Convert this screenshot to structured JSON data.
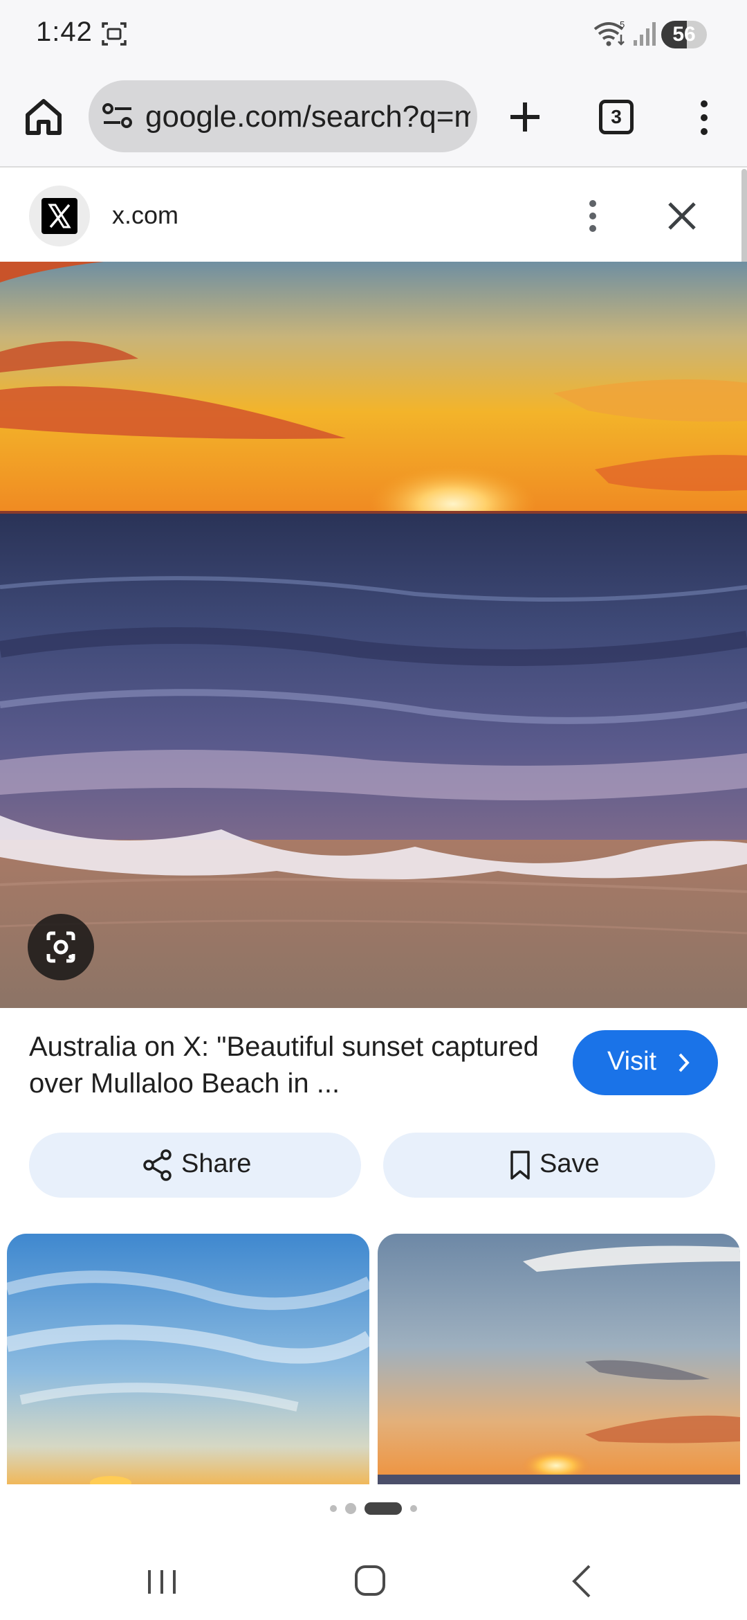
{
  "status_bar": {
    "time": "1:42",
    "battery_level": "56",
    "wifi_badge": "5",
    "icons": [
      "screenshot-icon",
      "wifi-icon",
      "signal-icon",
      "battery-icon"
    ]
  },
  "toolbar": {
    "url": "google.com/search?q=m",
    "tab_count": "3",
    "icons": [
      "home-icon",
      "tune-icon",
      "plus-icon",
      "tabs-icon",
      "more-vertical-icon"
    ]
  },
  "result": {
    "site_name": "x.com",
    "title": "Australia on X: \"Beautiful sunset captured over Mullaloo Beach in ...",
    "visit_label": "Visit",
    "share_label": "Share",
    "save_label": "Save",
    "icons": [
      "x-logo-icon",
      "more-vertical-icon",
      "close-icon",
      "lens-icon",
      "chevron-right-icon",
      "share-icon",
      "bookmark-icon"
    ]
  },
  "pager": {
    "count": 4,
    "active_index": 2
  },
  "colors": {
    "accent": "#1a73e8",
    "action_bg": "#e8f0fb",
    "chrome_bg": "#f7f7f9"
  }
}
